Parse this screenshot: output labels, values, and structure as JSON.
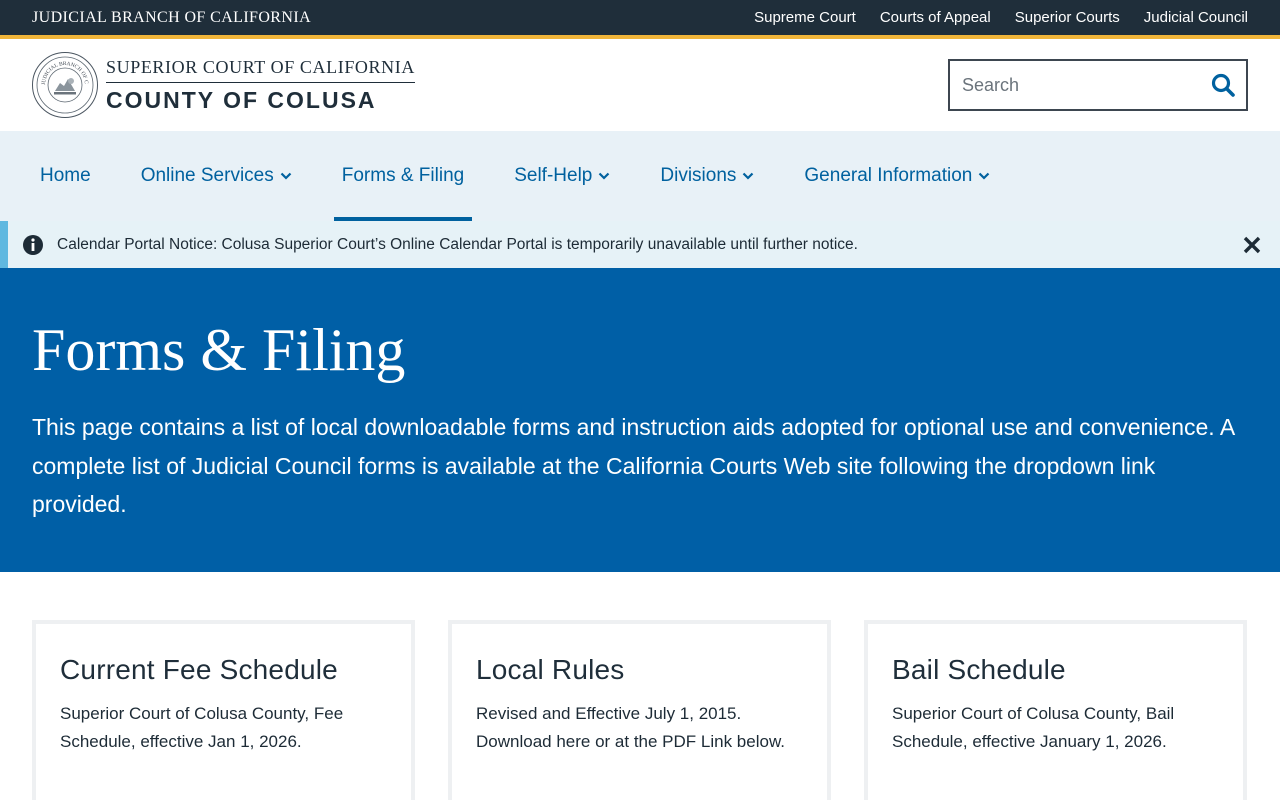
{
  "utility_bar": {
    "branch_name": "JUDICIAL BRANCH OF CALIFORNIA",
    "links": [
      "Supreme Court",
      "Courts of Appeal",
      "Superior Courts",
      "Judicial Council"
    ]
  },
  "header": {
    "court_line1": "SUPERIOR COURT OF CALIFORNIA",
    "court_line2": "COUNTY OF COLUSA",
    "seal_text": "JUDICIAL BRANCH OF CALIFORNIA",
    "search_placeholder": "Search"
  },
  "nav": {
    "items": [
      {
        "label": "Home",
        "dropdown": false
      },
      {
        "label": "Online Services",
        "dropdown": true
      },
      {
        "label": "Forms & Filing",
        "dropdown": false,
        "active": true
      },
      {
        "label": "Self-Help",
        "dropdown": true
      },
      {
        "label": "Divisions",
        "dropdown": true
      },
      {
        "label": "General Information",
        "dropdown": true
      }
    ]
  },
  "notice": {
    "text": "Calendar Portal Notice: Colusa Superior Court’s Online Calendar Portal is temporarily unavailable until further notice."
  },
  "hero": {
    "title": "Forms & Filing",
    "description": "This page contains a list of local downloadable forms and instruction aids adopted for optional use and convenience. A complete list of Judicial Council forms is available at the California Courts Web site following the dropdown link provided."
  },
  "cards": [
    {
      "title": "Current Fee Schedule",
      "text": "Superior Court of Colusa County, Fee Schedule, effective Jan 1, 2026."
    },
    {
      "title": "Local Rules",
      "text": "Revised and Effective July 1, 2015. Download here or at the PDF Link below."
    },
    {
      "title": "Bail Schedule",
      "text": "Superior Court of Colusa County, Bail Schedule, effective January 1, 2026."
    }
  ],
  "colors": {
    "utility_bg": "#1f2e3a",
    "gold_accent": "#f0b53a",
    "nav_bg": "#e8f1f7",
    "link_blue": "#00619f",
    "hero_bg": "#005fa6",
    "notice_bg": "#e6f2f7",
    "notice_border": "#5fb8e0"
  },
  "icons": {
    "search": "search-icon",
    "info": "info-icon",
    "close": "close-icon",
    "chevron": "chevron-down-icon",
    "seal": "court-seal-icon"
  }
}
